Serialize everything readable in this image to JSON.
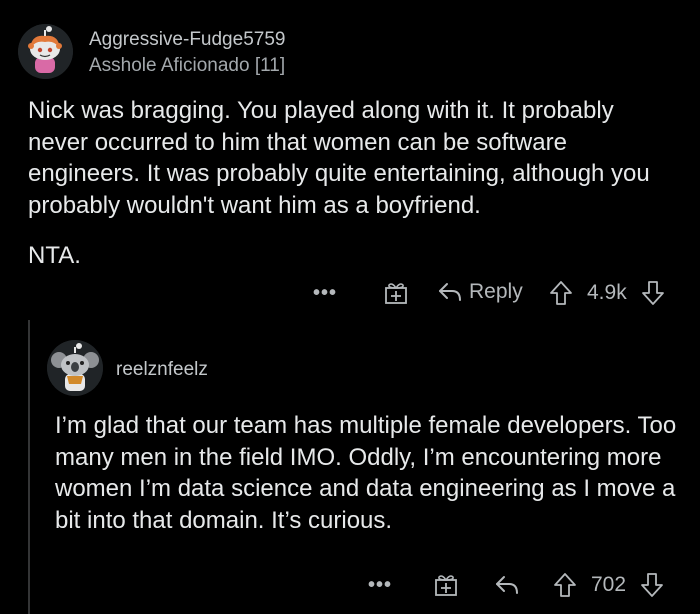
{
  "comment": {
    "username": "Aggressive-Fudge5759",
    "flair": "Asshole Aficionado [11]",
    "paragraphs": [
      "Nick was bragging. You played along with it. It probably never occurred to him that women can be software engineers. It was probably quite entertaining, although you probably wouldn't want him as a boyfriend.",
      "NTA."
    ],
    "actions": {
      "more_label": "•••",
      "reply_label": "Reply",
      "score": "4.9k"
    }
  },
  "reply": {
    "username": "reelznfeelz",
    "text": "I’m glad that our team has multiple female developers.  Too many men in the field IMO.  Oddly, I’m encountering more women I’m data science and data engineering as I move a bit into that domain.  It’s curious.",
    "actions": {
      "more_label": "•••",
      "score": "702"
    }
  },
  "colors": {
    "background": "#000000",
    "text": "#e7e9ea",
    "muted": "#b4b8bb",
    "thread_line": "#343536"
  },
  "icons": [
    "avatar",
    "award-gift-icon",
    "reply-arrow-icon",
    "upvote-icon",
    "downvote-icon",
    "more-options-icon"
  ]
}
